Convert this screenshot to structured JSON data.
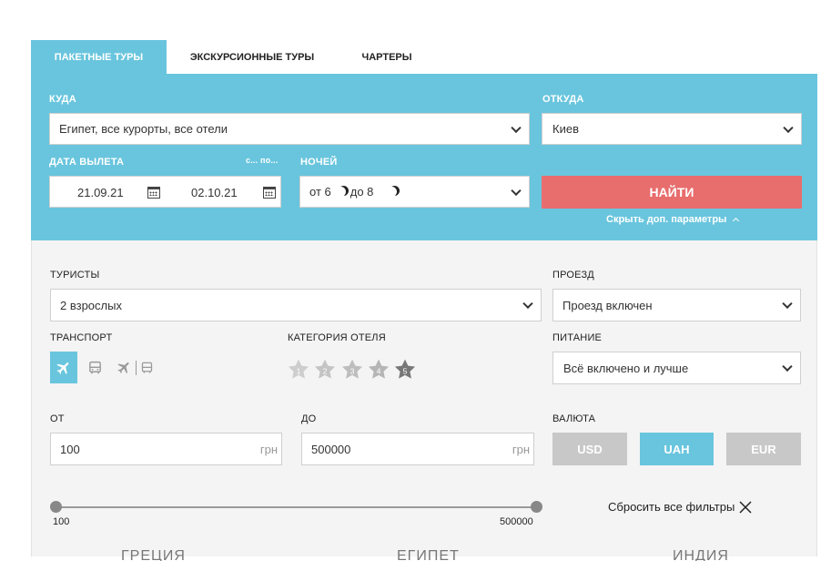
{
  "tabs": [
    {
      "label": "ПАКЕТНЫЕ ТУРЫ",
      "active": true
    },
    {
      "label": "ЭКСКУРСИОННЫЕ ТУРЫ",
      "active": false
    },
    {
      "label": "ЧАРТЕРЫ",
      "active": false
    }
  ],
  "search": {
    "to_label": "КУДА",
    "to_value": "Египет, все курорты, все отели",
    "from_label": "ОТКУДА",
    "from_value": "Киев",
    "date_label": "ДАТА ВЫЛЕТА",
    "date_range_hint": "с... по...",
    "date_from": "21.09.21",
    "date_to": "02.10.21",
    "nights_label": "НОЧЕЙ",
    "nights_from_prefix": "от 6",
    "nights_to_prefix": "до 8",
    "find_button": "НАЙТИ",
    "toggle_params": "Скрыть доп. параметры"
  },
  "filters": {
    "tourists_label": "ТУРИСТЫ",
    "tourists_value": "2 взрослых",
    "travel_label": "ПРОЕЗД",
    "travel_value": "Проезд включен",
    "transport_label": "ТРАНСПОРТ",
    "hotel_category_label": "КАТЕГОРИЯ ОТЕЛЯ",
    "stars": [
      "1",
      "2",
      "3",
      "4",
      "5"
    ],
    "selected_star": "5",
    "food_label": "ПИТАНИЕ",
    "food_value": "Всё включено и лучше",
    "price_from_label": "ОТ",
    "price_from_value": "100",
    "price_to_label": "ДО",
    "price_to_value": "500000",
    "currency_unit": "грн",
    "currency_label": "ВАЛЮТА",
    "currencies": [
      "USD",
      "UAH",
      "EUR"
    ],
    "selected_currency": "UAH",
    "range_min": "100",
    "range_max": "500000",
    "reset_label": "Сбросить все фильтры"
  },
  "colors": {
    "accent": "#69c5dd",
    "find": "#e86d6d",
    "inactive_currency": "#c8c8c8",
    "star_inactive": "#c9c9c9",
    "star_active": "#777777"
  },
  "below_fold": [
    "ГРЕЦИЯ",
    "ЕГИПЕТ",
    "ИНДИЯ"
  ]
}
